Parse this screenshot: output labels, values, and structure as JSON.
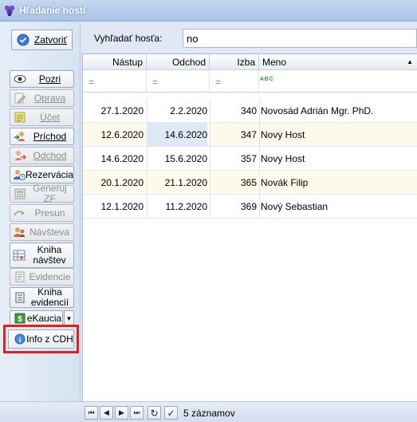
{
  "window": {
    "title": "Hľadanie hostí"
  },
  "sidebar": {
    "close_label": "Zatvoriť",
    "buttons": [
      {
        "label": "Pozri",
        "icon": "eye-icon",
        "enabled": true
      },
      {
        "label": "Oprava",
        "icon": "edit-icon",
        "enabled": false
      },
      {
        "label": "Účet",
        "icon": "bill-icon",
        "enabled": false
      },
      {
        "label": "Príchod",
        "icon": "arrival-icon",
        "enabled": true
      },
      {
        "label": "Odchod",
        "icon": "departure-icon",
        "enabled": false
      },
      {
        "label": "Rezervácia",
        "icon": "reservation-icon",
        "enabled": true
      },
      {
        "label": "Generuj ZF",
        "icon": "invoice-icon",
        "enabled": false
      },
      {
        "label": "Presun",
        "icon": "move-icon",
        "enabled": false
      },
      {
        "label": "Návšteva",
        "icon": "visit-icon",
        "enabled": false
      },
      {
        "label": "Kniha návštev",
        "icon": "visit-book-icon",
        "enabled": true
      },
      {
        "label": "Evidencie",
        "icon": "records-icon",
        "enabled": false
      },
      {
        "label": "Kniha evidencií",
        "icon": "records-book-icon",
        "enabled": true
      },
      {
        "label": "eKaucia",
        "icon": "deposit-icon",
        "enabled": true
      },
      {
        "label": "Info z CDH",
        "icon": "info-icon",
        "enabled": true
      }
    ]
  },
  "search": {
    "label": "Vyhľadať hosťa:",
    "value": "no"
  },
  "grid": {
    "columns": [
      "Nástup",
      "Odchod",
      "Izba",
      "Meno"
    ],
    "filter_symbol": "=",
    "rows": [
      {
        "nastup": "27.1.2020",
        "odchod": "2.2.2020",
        "izba": "340",
        "meno": "Novosád Adrián Mgr. PhD."
      },
      {
        "nastup": "12.6.2020",
        "odchod": "14.6.2020",
        "izba": "347",
        "meno": "Novy Host"
      },
      {
        "nastup": "14.6.2020",
        "odchod": "15.6.2020",
        "izba": "357",
        "meno": "Novy Host"
      },
      {
        "nastup": "20.1.2020",
        "odchod": "21.1.2020",
        "izba": "365",
        "meno": "Novák Filip"
      },
      {
        "nastup": "12.1.2020",
        "odchod": "11.2.2020",
        "izba": "369",
        "meno": "Nový Sebastian"
      }
    ]
  },
  "status": {
    "count_text": "5 záznamov"
  },
  "colors": {
    "highlight": "#e5201c",
    "selected_row": "#fefaeb"
  }
}
